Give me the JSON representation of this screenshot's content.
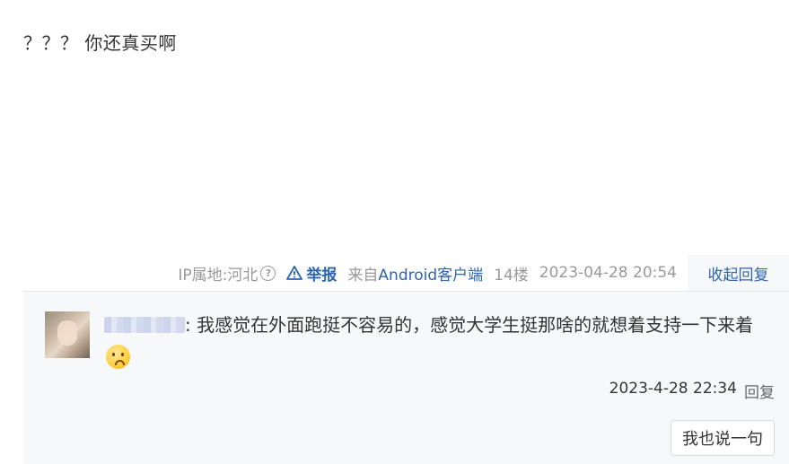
{
  "post": {
    "content": "？？？ 你还真买啊"
  },
  "meta": {
    "ip_location": "IP属地:河北",
    "help_icon": "?",
    "report_label": "举报",
    "from_prefix": "来自",
    "client": "Android客户端",
    "floor": "14楼",
    "timestamp": "2023-04-28 20:54",
    "collapse_label": "收起回复"
  },
  "reply": {
    "text_before": ": 我感觉在外面跑挺不容易的，感觉大学生挺那啥的就想着支持一下来着",
    "emoji": "shy-face-emoji",
    "timestamp": "2023-4-28 22:34",
    "reply_label": "回复"
  },
  "actions": {
    "say_button": "我也说一句"
  },
  "colors": {
    "link_blue": "#2d64b3",
    "meta_gray": "#999999",
    "panel_bg": "#f7f8fa"
  }
}
